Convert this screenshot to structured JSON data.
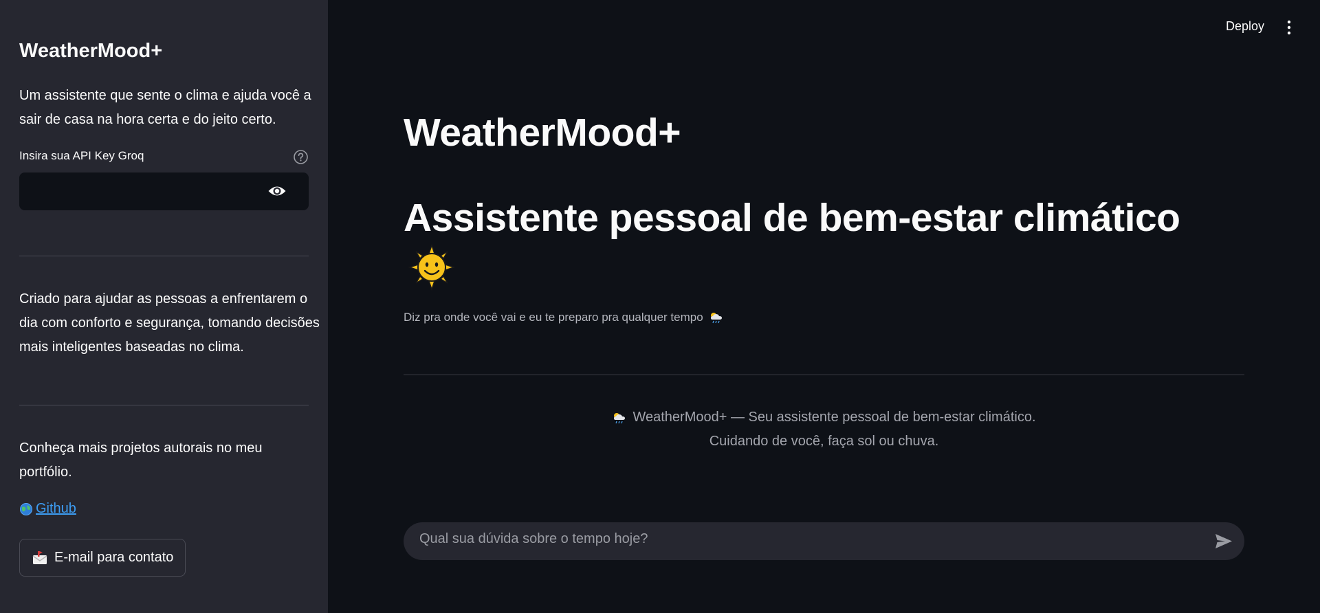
{
  "sidebar": {
    "title": "WeatherMood+",
    "description": "Um assistente que sente o clima e ajuda você a sair de casa na hora certa e do jeito certo.",
    "api_label": "Insira sua API Key Groq",
    "api_value": "",
    "created_text": "Criado para ajudar as pessoas a enfrentarem o dia com conforto e segurança, tomando decisões mais inteligentes baseadas no clima.",
    "portfolio_text": "Conheça mais projetos autorais no meu portfólio.",
    "github_label": "Github",
    "email_button_label": "E-mail para contato"
  },
  "header": {
    "deploy_label": "Deploy"
  },
  "main": {
    "title": "WeatherMood+",
    "subtitle": "Assistente pessoal de bem-estar climático",
    "caption": "Diz pra onde você vai e eu te preparo pra qualquer tempo",
    "footer_line1": "WeatherMood+ — Seu assistente pessoal de bem-estar climático.",
    "footer_line2": "Cuidando de você, faça sol ou chuva.",
    "chat_placeholder": "Qual sua dúvida sobre o tempo hoje?"
  },
  "colors": {
    "background": "#0e1117",
    "sidebar": "#262730",
    "link": "#3d9df3",
    "text": "#fafafa"
  },
  "icons": [
    "help-icon",
    "eye-icon",
    "globe-icon",
    "envelope-icon",
    "sun-face-icon",
    "cloud-rain-icon",
    "kebab-menu-icon",
    "send-icon"
  ]
}
